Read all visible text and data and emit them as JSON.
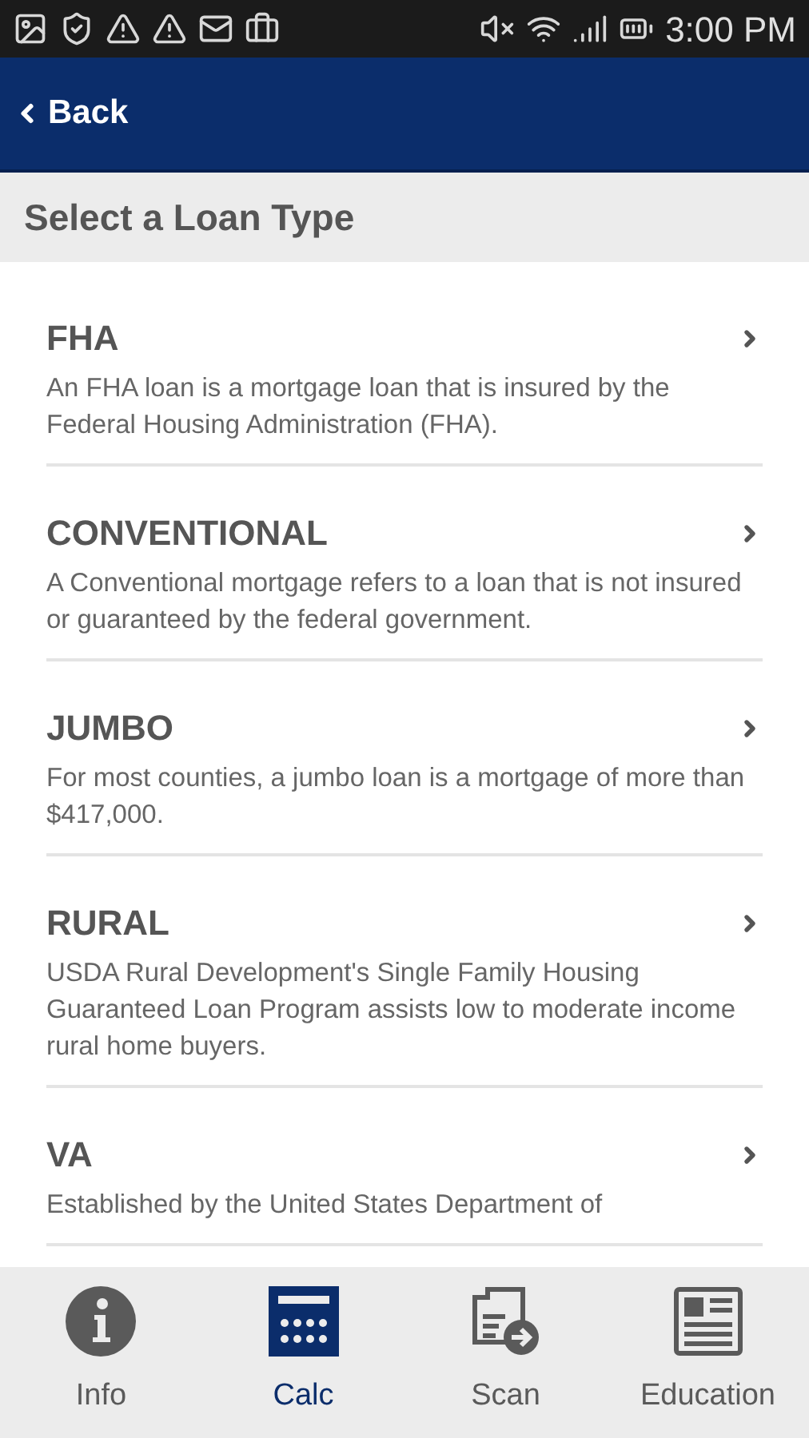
{
  "status_bar": {
    "time": "3:00 PM"
  },
  "header": {
    "back_label": "Back"
  },
  "section_title": "Select a Loan Type",
  "loan_types": [
    {
      "title": "FHA",
      "description": "An FHA loan is a mortgage loan that is insured by the Federal Housing Administration (FHA)."
    },
    {
      "title": "CONVENTIONAL",
      "description": "A Conventional mortgage refers to a loan that is not insured or guaranteed by the federal government."
    },
    {
      "title": "JUMBO",
      "description": "For most counties, a jumbo loan is a mortgage of more than $417,000."
    },
    {
      "title": "RURAL",
      "description": "USDA Rural Development's Single Family Housing Guaranteed Loan Program assists low to moderate income rural home buyers."
    },
    {
      "title": "VA",
      "description": "Established by the United States Department of"
    }
  ],
  "tab_bar": [
    {
      "label": "Info",
      "kind": "info",
      "selected": false
    },
    {
      "label": "Calc",
      "kind": "calc",
      "selected": true
    },
    {
      "label": "Scan",
      "kind": "scan",
      "selected": false
    },
    {
      "label": "Education",
      "kind": "education",
      "selected": false
    }
  ]
}
